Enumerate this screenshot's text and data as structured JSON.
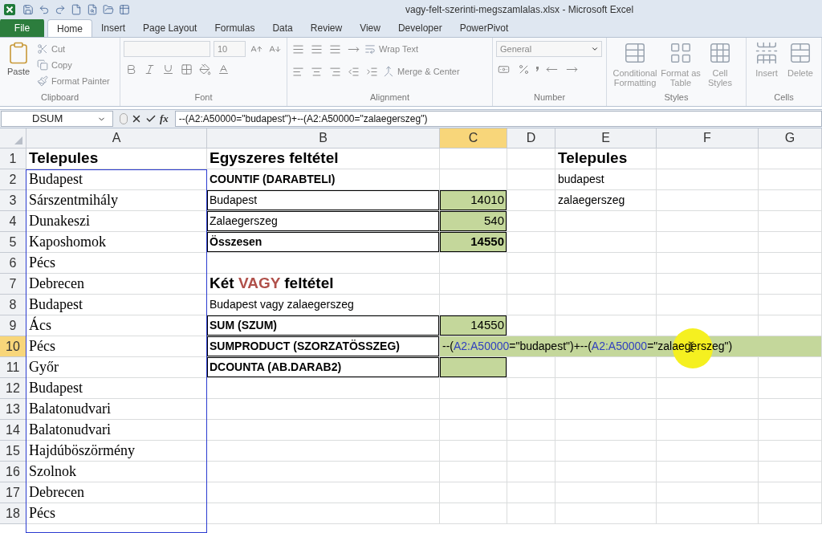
{
  "window": {
    "title": "vagy-felt-szerinti-megszamlalas.xlsx - Microsoft Excel"
  },
  "ribbon_tabs": [
    {
      "label": "File",
      "kind": "file",
      "selected": false
    },
    {
      "label": "Home",
      "kind": "tab",
      "selected": true
    },
    {
      "label": "Insert",
      "kind": "tab",
      "selected": false
    },
    {
      "label": "Page Layout",
      "kind": "tab",
      "selected": false
    },
    {
      "label": "Formulas",
      "kind": "tab",
      "selected": false
    },
    {
      "label": "Data",
      "kind": "tab",
      "selected": false
    },
    {
      "label": "Review",
      "kind": "tab",
      "selected": false
    },
    {
      "label": "View",
      "kind": "tab",
      "selected": false
    },
    {
      "label": "Developer",
      "kind": "tab",
      "selected": false
    },
    {
      "label": "PowerPivot",
      "kind": "tab",
      "selected": false
    }
  ],
  "ribbon_groups": [
    {
      "kind": "clipboard",
      "label": "Clipboard",
      "buttons": [
        "Paste",
        "Cut",
        "Copy",
        "Format Painter"
      ]
    },
    {
      "kind": "font",
      "label": "Font",
      "font_size": "10"
    },
    {
      "kind": "alignment",
      "label": "Alignment",
      "buttons": [
        "Wrap Text",
        "Merge & Center"
      ]
    },
    {
      "kind": "number",
      "label": "Number",
      "format": "General"
    },
    {
      "kind": "styles",
      "label": "Styles",
      "buttons": [
        "Conditional Formatting",
        "Format as Table",
        "Cell Styles"
      ]
    },
    {
      "kind": "cells",
      "label": "Cells",
      "buttons": [
        "Insert",
        "Delete"
      ]
    }
  ],
  "formula_bar": {
    "name_box": "DSUM",
    "function_button": "fx",
    "formula": "--(A2:A50000=\"budapest\")+--(A2:A50000=\"zalaegerszeg\")"
  },
  "columns": [
    {
      "label": "A",
      "selected": false,
      "referenced": true
    },
    {
      "label": "B",
      "selected": false,
      "referenced": false
    },
    {
      "label": "C",
      "selected": true,
      "referenced": false
    },
    {
      "label": "D",
      "selected": false,
      "referenced": false
    },
    {
      "label": "E",
      "selected": false,
      "referenced": false
    },
    {
      "label": "F",
      "selected": false,
      "referenced": false
    },
    {
      "label": "G",
      "selected": false,
      "referenced": false
    }
  ],
  "rows": [
    {
      "number": "1",
      "selected": false,
      "cells": {
        "A": {
          "text": "Telepules",
          "kind": "header"
        },
        "B": {
          "text": "Egyszeres feltétel",
          "kind": "header"
        },
        "E": {
          "text": "Telepules",
          "kind": "header"
        }
      }
    },
    {
      "number": "2",
      "selected": false,
      "cells": {
        "A": {
          "text": "Budapest",
          "kind": "city"
        },
        "B": {
          "text": "COUNTIF (DARABTELI)",
          "kind": "strong"
        },
        "E": {
          "text": "budapest",
          "kind": "label"
        }
      }
    },
    {
      "number": "3",
      "selected": false,
      "cells": {
        "A": {
          "text": "Sárszentmihály",
          "kind": "city"
        },
        "B": {
          "text": "Budapest",
          "kind": "label",
          "bordered": true
        },
        "C": {
          "text": "14010",
          "kind": "number",
          "bordered": true,
          "filled": true
        },
        "E": {
          "text": "zalaegerszeg",
          "kind": "label"
        }
      }
    },
    {
      "number": "4",
      "selected": false,
      "cells": {
        "A": {
          "text": "Dunakeszi",
          "kind": "city"
        },
        "B": {
          "text": "Zalaegerszeg",
          "kind": "label",
          "bordered": true
        },
        "C": {
          "text": "540",
          "kind": "number",
          "bordered": true,
          "filled": true
        }
      }
    },
    {
      "number": "5",
      "selected": false,
      "cells": {
        "A": {
          "text": "Kaposhomok",
          "kind": "city"
        },
        "B": {
          "text": "Összesen",
          "kind": "strong",
          "bordered": true
        },
        "C": {
          "text": "14550",
          "kind": "strong_number",
          "bordered": true,
          "filled": true
        }
      }
    },
    {
      "number": "6",
      "selected": false,
      "cells": {
        "A": {
          "text": "Pécs",
          "kind": "city"
        }
      }
    },
    {
      "number": "7",
      "selected": false,
      "cells": {
        "A": {
          "text": "Debrecen",
          "kind": "city"
        },
        "B": {
          "kind": "header",
          "parts": [
            {
              "text": "Két ",
              "kind": "plain"
            },
            {
              "text": "VAGY",
              "kind": "emphasis"
            },
            {
              "text": " feltétel",
              "kind": "plain"
            }
          ]
        }
      }
    },
    {
      "number": "8",
      "selected": false,
      "cells": {
        "A": {
          "text": "Budapest",
          "kind": "city"
        },
        "B": {
          "text": "Budapest vagy zalaegerszeg",
          "kind": "label"
        }
      }
    },
    {
      "number": "9",
      "selected": false,
      "cells": {
        "A": {
          "text": "Ács",
          "kind": "city"
        },
        "B": {
          "text": "SUM (SZUM)",
          "kind": "strong",
          "bordered": true
        },
        "C": {
          "text": "14550",
          "kind": "number",
          "bordered": true,
          "filled": true
        }
      }
    },
    {
      "number": "10",
      "selected": true,
      "cells": {
        "A": {
          "text": "Pécs",
          "kind": "city"
        },
        "B": {
          "text": "SUMPRODUCT (SZORZATÖSSZEG)",
          "kind": "strong",
          "bordered": true
        },
        "C": {
          "kind": "formula",
          "filled": true,
          "parts": [
            {
              "text": "--(",
              "kind": "plain"
            },
            {
              "text": "A2:A50000",
              "kind": "reference"
            },
            {
              "text": "=\"budapest\")+--(",
              "kind": "plain"
            },
            {
              "text": "A2:A50000",
              "kind": "reference"
            },
            {
              "text": "=\"zalaegerszeg\")",
              "kind": "plain"
            }
          ]
        }
      }
    },
    {
      "number": "11",
      "selected": false,
      "cells": {
        "A": {
          "text": "Győr",
          "kind": "city"
        },
        "B": {
          "text": "DCOUNTA (AB.DARAB2)",
          "kind": "strong",
          "bordered": true
        },
        "C": {
          "kind": "number",
          "bordered": true,
          "filled": true
        }
      }
    },
    {
      "number": "12",
      "selected": false,
      "cells": {
        "A": {
          "text": "Budapest",
          "kind": "city"
        }
      }
    },
    {
      "number": "13",
      "selected": false,
      "cells": {
        "A": {
          "text": "Balatonudvari",
          "kind": "city"
        }
      }
    },
    {
      "number": "14",
      "selected": false,
      "cells": {
        "A": {
          "text": "Balatonudvari",
          "kind": "city"
        }
      }
    },
    {
      "number": "15",
      "selected": false,
      "cells": {
        "A": {
          "text": "Hajdúböszörmény",
          "kind": "city"
        }
      }
    },
    {
      "number": "16",
      "selected": false,
      "cells": {
        "A": {
          "text": "Szolnok",
          "kind": "city"
        }
      }
    },
    {
      "number": "17",
      "selected": false,
      "cells": {
        "A": {
          "text": "Debrecen",
          "kind": "city"
        }
      }
    },
    {
      "number": "18",
      "selected": false,
      "cells": {
        "A": {
          "text": "Pécs",
          "kind": "city"
        }
      }
    }
  ]
}
